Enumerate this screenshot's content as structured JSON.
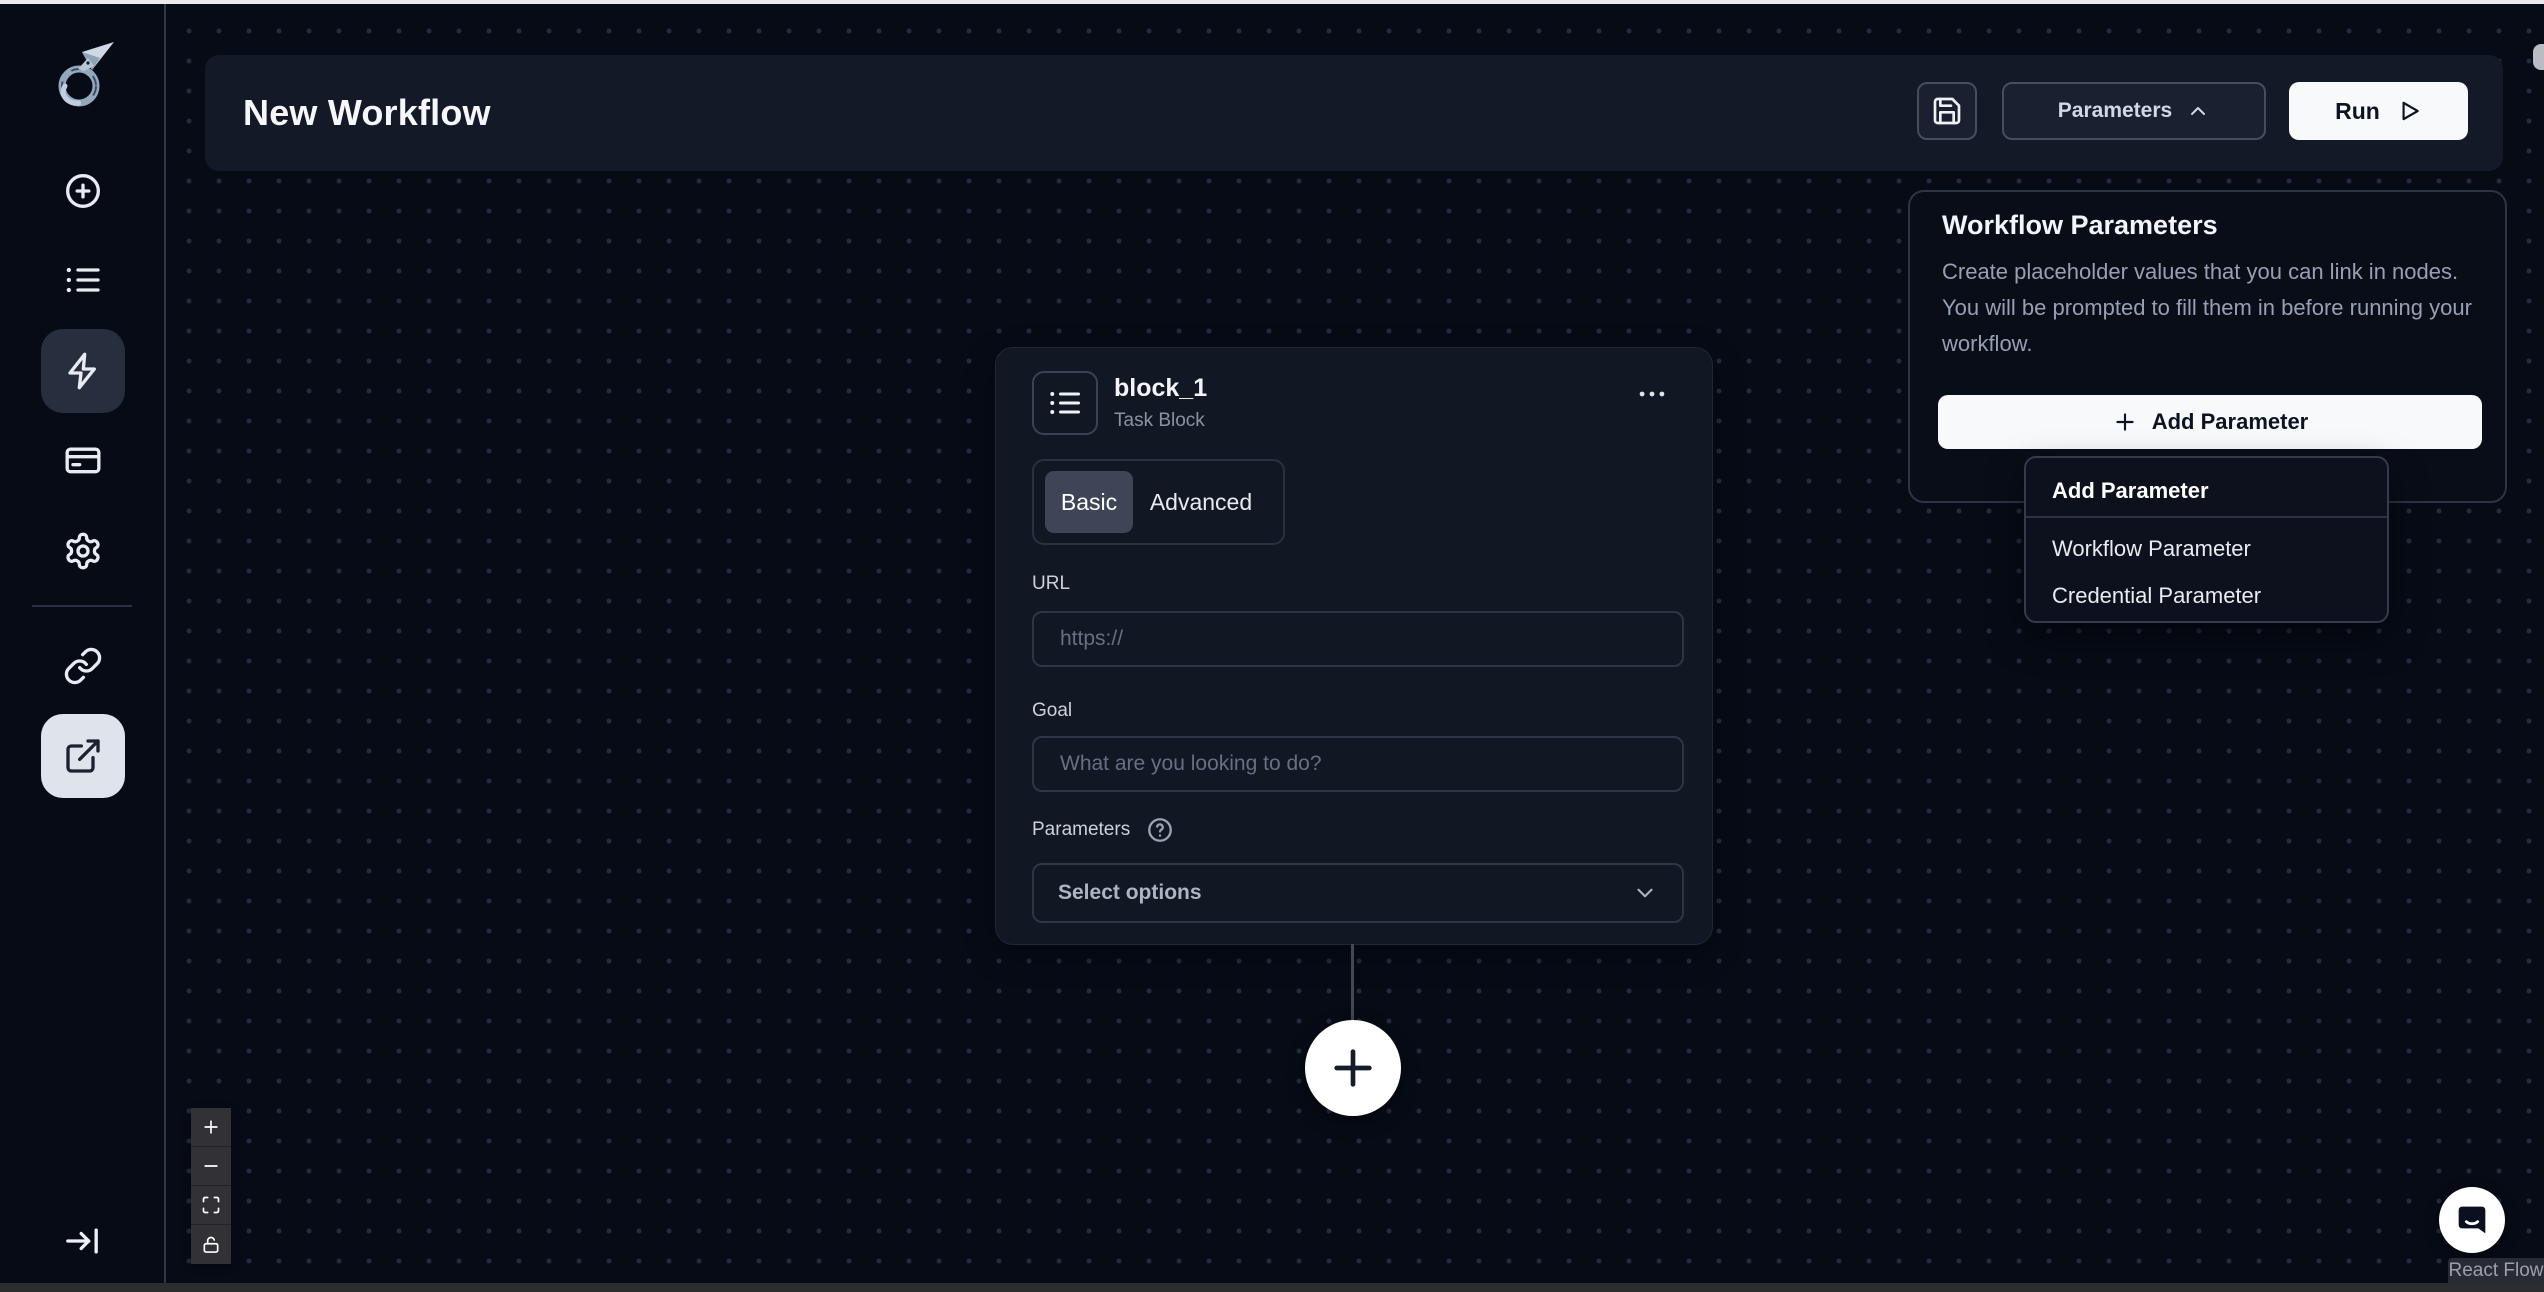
{
  "topbar": {
    "title": "New Workflow",
    "save_icon": "floppy-disk",
    "parameters_button": "Parameters",
    "parameters_chevron_icon": "chevron-up",
    "run_button": "Run",
    "run_icon": "play"
  },
  "sidebar": {
    "logo_icon": "dragon-logo",
    "items": [
      {
        "id": "create",
        "icon": "plus-circle",
        "selected": false
      },
      {
        "id": "runs",
        "icon": "list",
        "selected": false
      },
      {
        "id": "workflows",
        "icon": "lightning",
        "selected": true
      },
      {
        "id": "credentials",
        "icon": "credit-card",
        "selected": false
      },
      {
        "id": "settings",
        "icon": "gear",
        "selected": false
      },
      {
        "id": "integrations",
        "icon": "link",
        "selected": false
      },
      {
        "id": "external",
        "icon": "external-link",
        "selected": true
      }
    ],
    "collapse_icon": "arrow-right-to-line"
  },
  "node": {
    "icon": "list",
    "title": "block_1",
    "type_label": "Task Block",
    "menu_icon": "ellipsis",
    "tabs": [
      "Basic",
      "Advanced"
    ],
    "active_tab": "Basic",
    "url_label": "URL",
    "url_placeholder": "https://",
    "url_value": "",
    "goal_label": "Goal",
    "goal_placeholder": "What are you looking to do?",
    "goal_value": "",
    "parameters_label": "Parameters",
    "help_icon": "help-circle",
    "select_placeholder": "Select options",
    "select_chevron_icon": "chevron-down"
  },
  "canvas": {
    "add_node_icon": "plus",
    "controls": [
      {
        "id": "zoom-in",
        "icon": "plus"
      },
      {
        "id": "zoom-out",
        "icon": "minus"
      },
      {
        "id": "fit-view",
        "icon": "maximize"
      },
      {
        "id": "lock",
        "icon": "lock"
      }
    ]
  },
  "panel": {
    "title": "Workflow Parameters",
    "description": "Create placeholder values that you can link in nodes. You will be prompted to fill them in before running your workflow.",
    "add_button": "Add Parameter",
    "add_icon": "plus"
  },
  "dropdown": {
    "header": "Add Parameter",
    "items": [
      "Workflow Parameter",
      "Credential Parameter"
    ]
  },
  "misc": {
    "chat_icon": "chat-bubble",
    "attribution": "React Flow"
  },
  "colors": {
    "canvas_bg": "#060b16",
    "surface_bg": "#141927",
    "panel_bg": "#080d18",
    "border": "#2e3646",
    "accent_white": "#f8f9fb",
    "muted_text": "#97a0b2",
    "selected_item_bg": "#272e3d",
    "selected_tab_bg": "#3d4557"
  }
}
